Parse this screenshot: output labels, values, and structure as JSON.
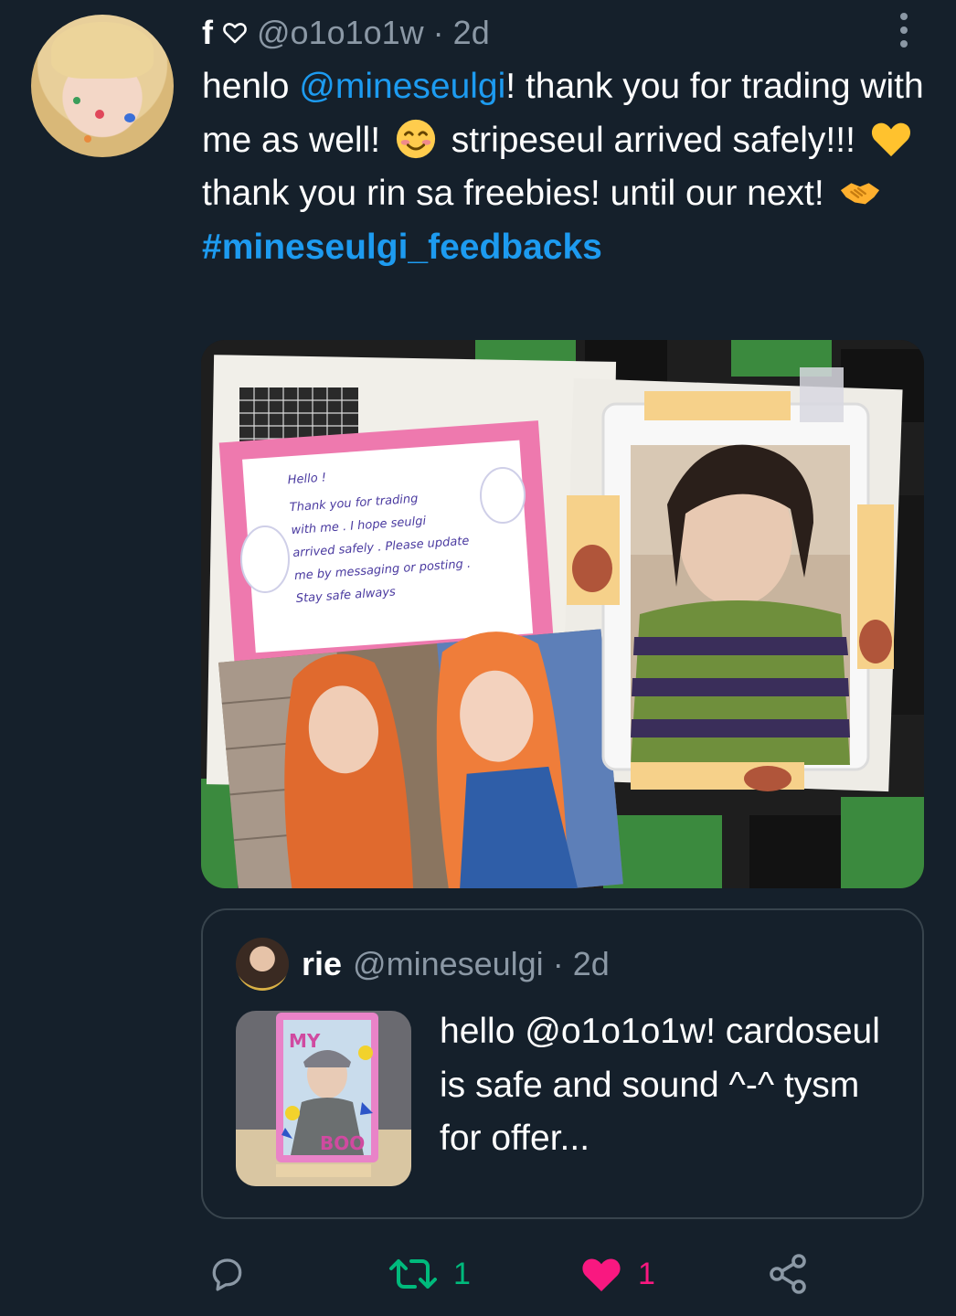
{
  "author": {
    "name": "f",
    "handle": "@o1o1o1w",
    "separator": "·",
    "time": "2d"
  },
  "tweet": {
    "segments": {
      "t1": "henlo ",
      "mention": "@mineseulgi",
      "t2": "! thank you for trading with me as well! ",
      "t3": " stripeseul arrived safely!!! ",
      "t4": " thank you rin sa freebies! until our next! ",
      "hashtag": "#mineseulgi_feedbacks"
    },
    "emojis": [
      "smiling-face-emoji",
      "yellow-heart-emoji",
      "handshake-emoji"
    ]
  },
  "media": {
    "note_lines": [
      "Hello !",
      "Thank you for trading",
      "with me . I hope seulgi",
      "arrived safely . Please update",
      "me by messaging or posting .",
      "Stay safe always"
    ]
  },
  "quote": {
    "name": "rie",
    "handle": "@mineseulgi",
    "separator": "·",
    "time": "2d",
    "text": "hello @o1o1o1w! cardoseul is safe and sound ^-^ tysm for offer...",
    "thumb_labels": [
      "MY",
      "BOO"
    ]
  },
  "actions": {
    "reply_count": "",
    "retweet_count": "1",
    "like_count": "1"
  },
  "colors": {
    "background": "#15202b",
    "link": "#1d9bf0",
    "secondary_text": "#8b98a5",
    "retweet": "#00ba7c",
    "like": "#f91880",
    "border": "#38444d"
  }
}
